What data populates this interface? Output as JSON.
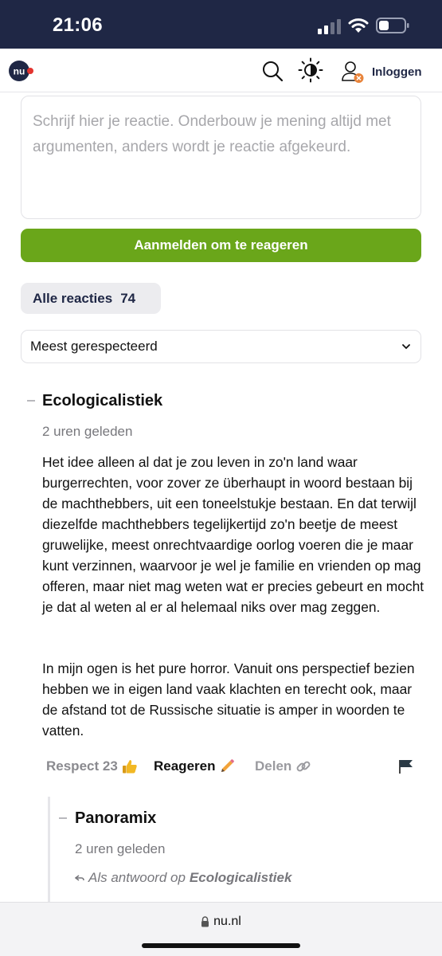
{
  "status_bar": {
    "time": "21:06"
  },
  "header": {
    "logo": "nu-logo",
    "login_label": "Inloggen"
  },
  "comment_form": {
    "placeholder": "Schrijf hier je reactie. Onderbouw je mening altijd met argumenten, anders wordt je reactie afgekeurd.",
    "submit_label": "Aanmelden om te reageren"
  },
  "reactions": {
    "label": "Alle reacties",
    "count": "74",
    "sort_selected": "Meest gerespecteerd"
  },
  "comments": [
    {
      "author": "Ecologicalistiek",
      "time": "2 uren geleden",
      "paragraphs": [
        "Het idee alleen al dat je zou leven in zo'n land waar burgerrechten, voor zover ze überhaupt in woord bestaan bij de machthebbers, uit een toneelstukje bestaan. En dat terwijl diezelfde machthebbers tegelijkertijd zo'n beetje de meest gruwelijke, meest onrechtvaardige oorlog voeren die je maar kunt verzinnen, waarvoor je wel je familie en vrienden op mag offeren, maar niet mag weten wat er precies gebeurt en mocht je dat al weten al er al helemaal niks over mag zeggen.",
        "In mijn ogen is het pure horror. Vanuit ons perspectief bezien hebben we in eigen land vaak klachten en terecht ook, maar de afstand tot de Russische situatie is amper in woorden te vatten."
      ],
      "respect_label": "Respect 23",
      "reply_label": "Reageren",
      "share_label": "Delen"
    },
    {
      "author": "Panoramix",
      "time": "2 uren geleden",
      "reply_to_prefix": "Als antwoord op",
      "reply_to_author": "Ecologicalistiek"
    }
  ],
  "browser": {
    "url": "nu.nl"
  },
  "colors": {
    "brand_navy": "#1f2745",
    "submit_green": "#6aa61a",
    "notification_orange": "#e8833a",
    "logo_red": "#e3342f"
  }
}
